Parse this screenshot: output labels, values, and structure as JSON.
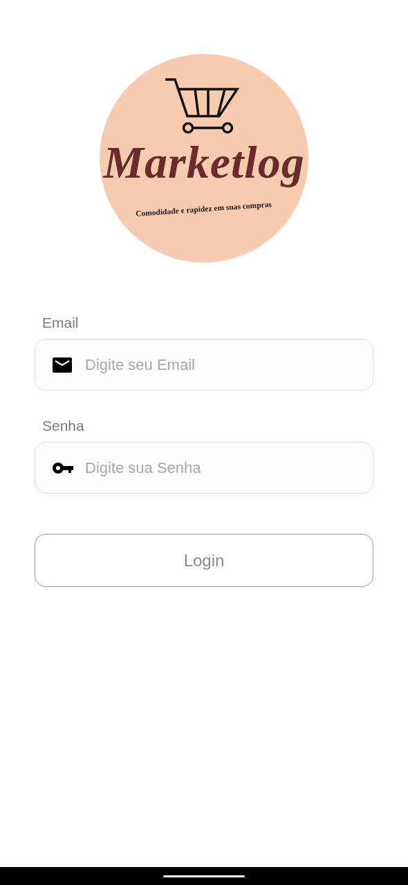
{
  "logo": {
    "title": "Marketlog",
    "tagline": "Comodidade e rapidez em suas compras"
  },
  "fields": [
    {
      "kind": "email",
      "label": "Email",
      "placeholder": "Digite seu Email"
    },
    {
      "kind": "password",
      "label": "Senha",
      "placeholder": "Digite sua Senha"
    }
  ],
  "button": {
    "label": "Login"
  }
}
